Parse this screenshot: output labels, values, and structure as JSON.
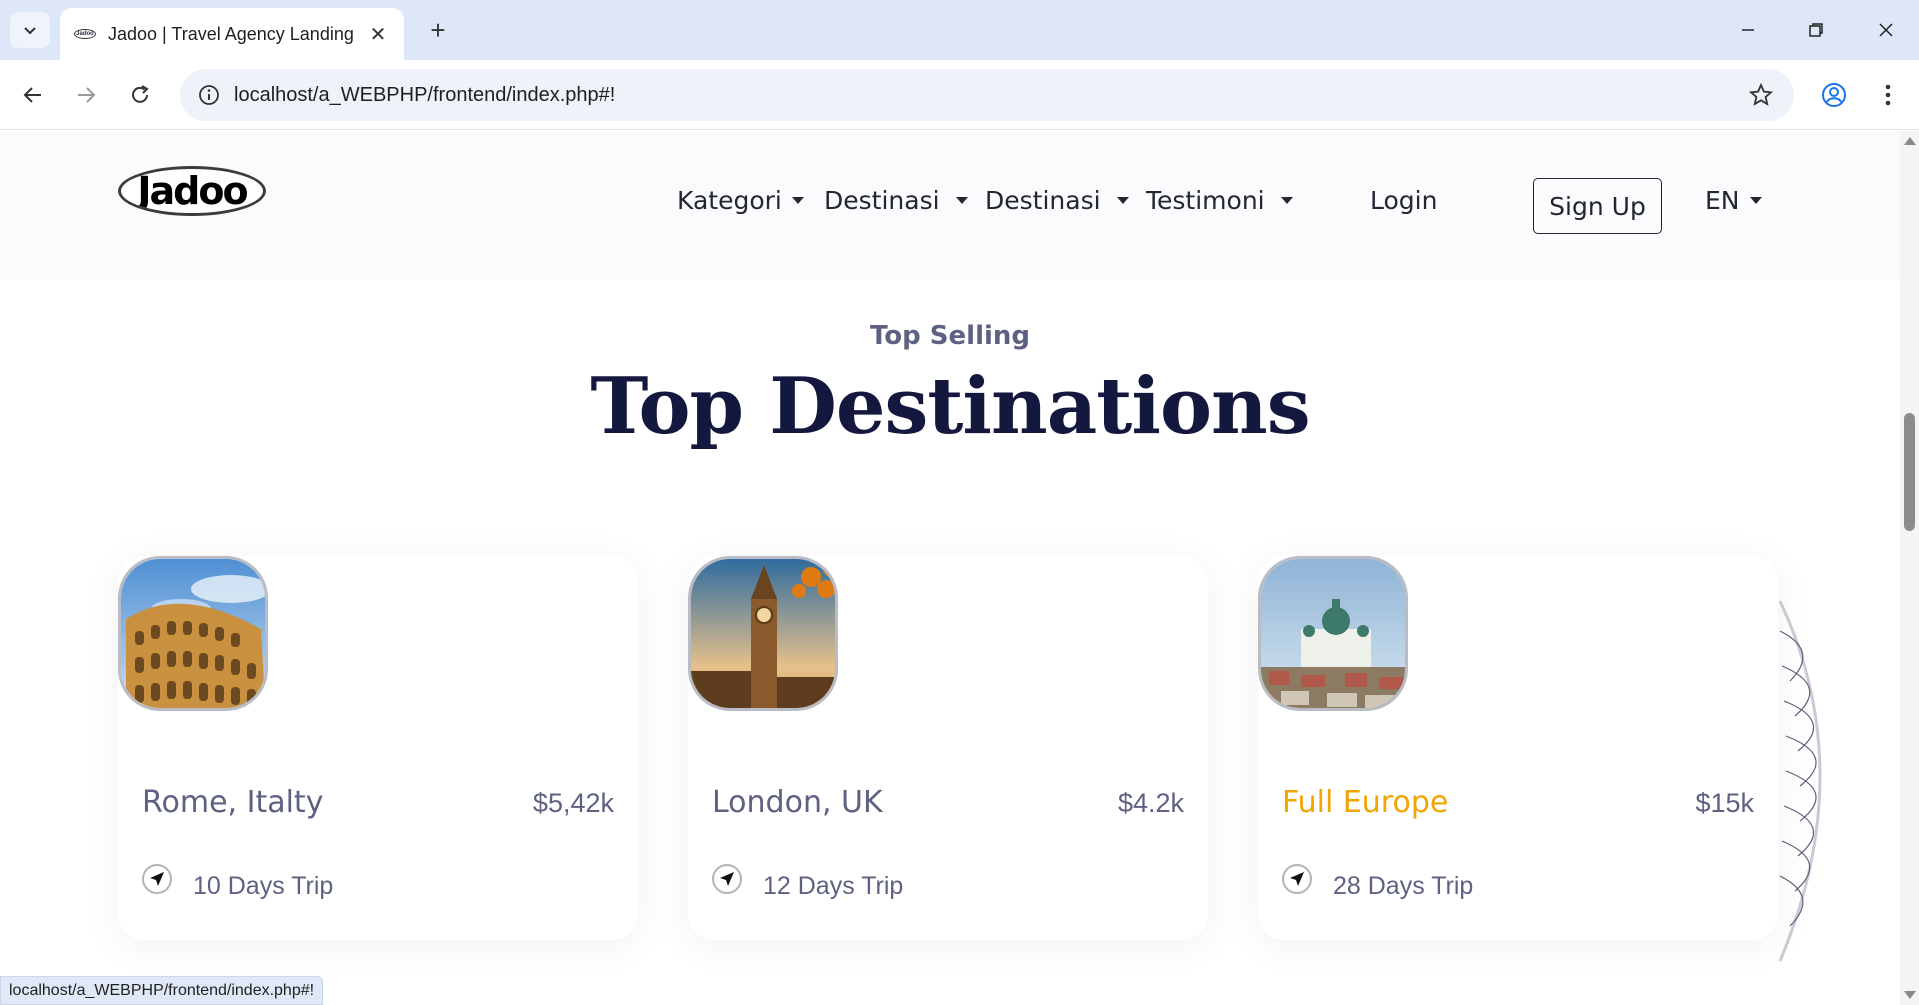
{
  "browser": {
    "tab_title": "Jadoo | Travel Agency Landing Page",
    "favicon_text": "Jadoo",
    "url": "localhost/a_WEBPHP/frontend/index.php#!",
    "status_url": "localhost/a_WEBPHP/frontend/index.php#!"
  },
  "nav": {
    "logo_text": "Jadoo",
    "items": [
      "Kategori",
      "Destinasi",
      "Destinasi",
      "Testimoni"
    ],
    "login": "Login",
    "signup": "Sign Up",
    "language": "EN"
  },
  "section": {
    "eyebrow": "Top Selling",
    "title": "Top Destinations"
  },
  "destinations": [
    {
      "name": "Rome, Italty",
      "price": "$5,42k",
      "trip": "10 Days Trip",
      "image": "colosseum-photo",
      "name_color": "#5e6282"
    },
    {
      "name": "London, UK",
      "price": "$4.2k",
      "trip": "12 Days Trip",
      "image": "big-ben-photo",
      "name_color": "#5e6282"
    },
    {
      "name": "Full Europe",
      "price": "$15k",
      "trip": "28 Days Trip",
      "image": "helsinki-cathedral-photo",
      "name_color": "#f1a501"
    }
  ],
  "colors": {
    "accent": "#f1a501",
    "heading": "#14183e",
    "text_muted": "#5e6282"
  }
}
